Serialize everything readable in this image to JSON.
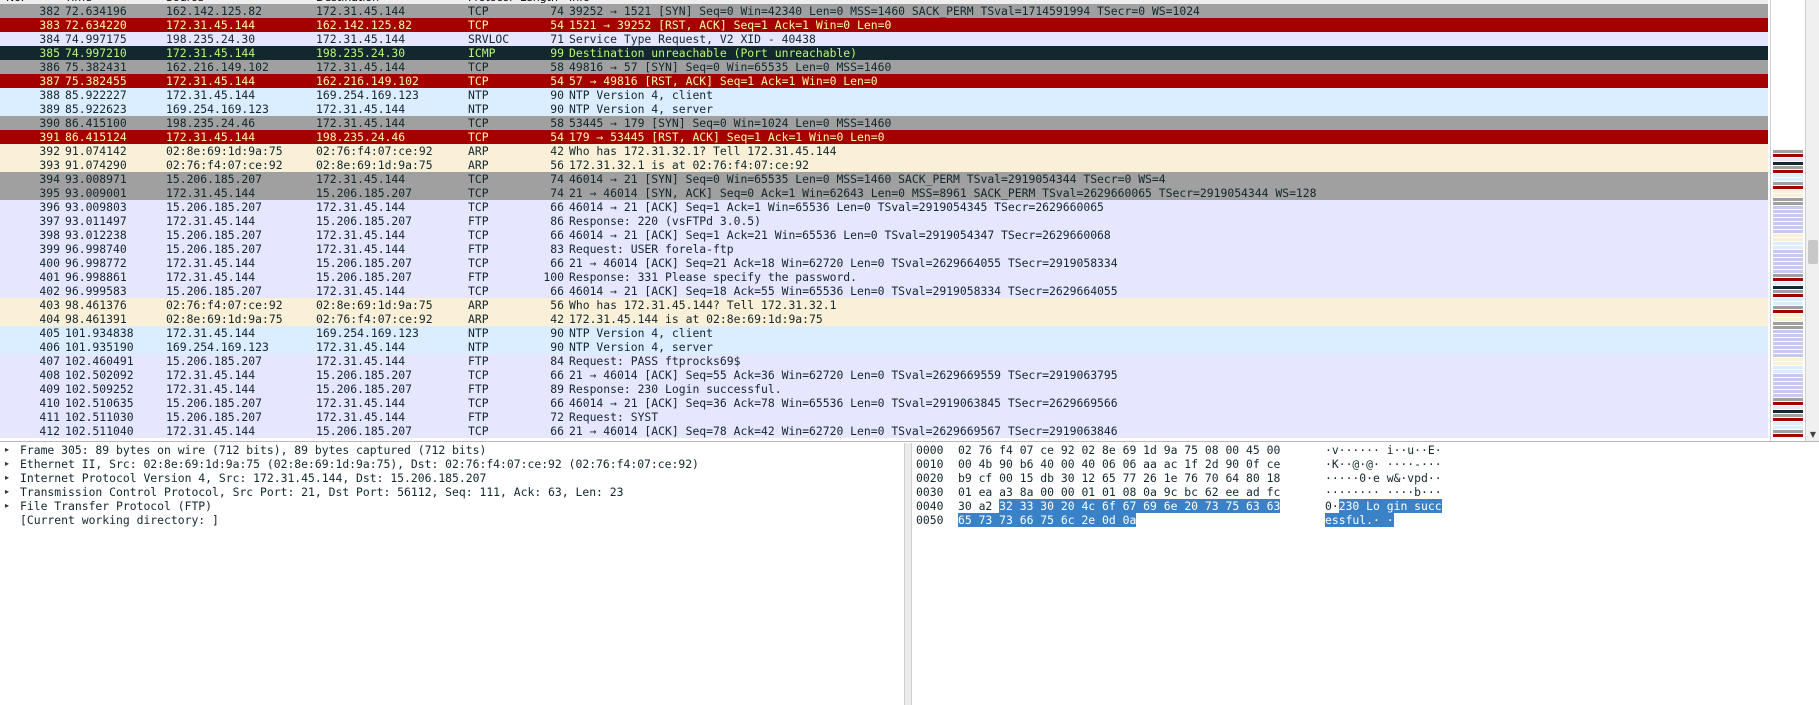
{
  "columns": [
    "No.",
    "Time",
    "Source",
    "Destination",
    "Protocol",
    "Length",
    "Info"
  ],
  "packets": [
    {
      "no": "382",
      "time": "72.634196",
      "src": "162.142.125.82",
      "dst": "172.31.45.144",
      "proto": "TCP",
      "len": "74",
      "info": "39252 → 1521 [SYN] Seq=0 Win=42340 Len=0 MSS=1460 SACK_PERM TSval=1714591994 TSecr=0 WS=1024",
      "style": "tcp-gray"
    },
    {
      "no": "383",
      "time": "72.634220",
      "src": "172.31.45.144",
      "dst": "162.142.125.82",
      "proto": "TCP",
      "len": "54",
      "info": "1521 → 39252 [RST, ACK] Seq=1 Ack=1 Win=0 Len=0",
      "style": "rst"
    },
    {
      "no": "384",
      "time": "74.997175",
      "src": "198.235.24.30",
      "dst": "172.31.45.144",
      "proto": "SRVLOC",
      "len": "71",
      "info": "Service Type Request, V2 XID - 40438",
      "style": "srvloc"
    },
    {
      "no": "385",
      "time": "74.997210",
      "src": "172.31.45.144",
      "dst": "198.235.24.30",
      "proto": "ICMP",
      "len": "99",
      "info": "Destination unreachable (Port unreachable)",
      "style": "icmp"
    },
    {
      "no": "386",
      "time": "75.382431",
      "src": "162.216.149.102",
      "dst": "172.31.45.144",
      "proto": "TCP",
      "len": "58",
      "info": "49816 → 57 [SYN] Seq=0 Win=65535 Len=0 MSS=1460",
      "style": "tcp-gray"
    },
    {
      "no": "387",
      "time": "75.382455",
      "src": "172.31.45.144",
      "dst": "162.216.149.102",
      "proto": "TCP",
      "len": "54",
      "info": "57 → 49816 [RST, ACK] Seq=1 Ack=1 Win=0 Len=0",
      "style": "rst"
    },
    {
      "no": "388",
      "time": "85.922227",
      "src": "172.31.45.144",
      "dst": "169.254.169.123",
      "proto": "NTP",
      "len": "90",
      "info": "NTP Version 4, client",
      "style": "ntp"
    },
    {
      "no": "389",
      "time": "85.922623",
      "src": "169.254.169.123",
      "dst": "172.31.45.144",
      "proto": "NTP",
      "len": "90",
      "info": "NTP Version 4, server",
      "style": "ntp"
    },
    {
      "no": "390",
      "time": "86.415100",
      "src": "198.235.24.46",
      "dst": "172.31.45.144",
      "proto": "TCP",
      "len": "58",
      "info": "53445 → 179 [SYN] Seq=0 Win=1024 Len=0 MSS=1460",
      "style": "tcp-gray"
    },
    {
      "no": "391",
      "time": "86.415124",
      "src": "172.31.45.144",
      "dst": "198.235.24.46",
      "proto": "TCP",
      "len": "54",
      "info": "179 → 53445 [RST, ACK] Seq=1 Ack=1 Win=0 Len=0",
      "style": "rst"
    },
    {
      "no": "392",
      "time": "91.074142",
      "src": "02:8e:69:1d:9a:75",
      "dst": "02:76:f4:07:ce:92",
      "proto": "ARP",
      "len": "42",
      "info": "Who has 172.31.32.1? Tell 172.31.45.144",
      "style": "arp"
    },
    {
      "no": "393",
      "time": "91.074290",
      "src": "02:76:f4:07:ce:92",
      "dst": "02:8e:69:1d:9a:75",
      "proto": "ARP",
      "len": "56",
      "info": "172.31.32.1 is at 02:76:f4:07:ce:92",
      "style": "arp"
    },
    {
      "no": "394",
      "time": "93.008971",
      "src": "15.206.185.207",
      "dst": "172.31.45.144",
      "proto": "TCP",
      "len": "74",
      "info": "46014 → 21 [SYN] Seq=0 Win=65535 Len=0 MSS=1460 SACK_PERM TSval=2919054344 TSecr=0 WS=4",
      "style": "tcp-gray"
    },
    {
      "no": "395",
      "time": "93.009001",
      "src": "172.31.45.144",
      "dst": "15.206.185.207",
      "proto": "TCP",
      "len": "74",
      "info": "21 → 46014 [SYN, ACK] Seq=0 Ack=1 Win=62643 Len=0 MSS=8961 SACK_PERM TSval=2629660065 TSecr=2919054344 WS=128",
      "style": "tcp-gray"
    },
    {
      "no": "396",
      "time": "93.009803",
      "src": "15.206.185.207",
      "dst": "172.31.45.144",
      "proto": "TCP",
      "len": "66",
      "info": "46014 → 21 [ACK] Seq=1 Ack=1 Win=65536 Len=0 TSval=2919054345 TSecr=2629660065",
      "style": "ftp"
    },
    {
      "no": "397",
      "time": "93.011497",
      "src": "172.31.45.144",
      "dst": "15.206.185.207",
      "proto": "FTP",
      "len": "86",
      "info": "Response: 220 (vsFTPd 3.0.5)",
      "style": "ftp"
    },
    {
      "no": "398",
      "time": "93.012238",
      "src": "15.206.185.207",
      "dst": "172.31.45.144",
      "proto": "TCP",
      "len": "66",
      "info": "46014 → 21 [ACK] Seq=1 Ack=21 Win=65536 Len=0 TSval=2919054347 TSecr=2629660068",
      "style": "ftp"
    },
    {
      "no": "399",
      "time": "96.998740",
      "src": "15.206.185.207",
      "dst": "172.31.45.144",
      "proto": "FTP",
      "len": "83",
      "info": "Request: USER forela-ftp",
      "style": "ftp"
    },
    {
      "no": "400",
      "time": "96.998772",
      "src": "172.31.45.144",
      "dst": "15.206.185.207",
      "proto": "TCP",
      "len": "66",
      "info": "21 → 46014 [ACK] Seq=21 Ack=18 Win=62720 Len=0 TSval=2629664055 TSecr=2919058334",
      "style": "ftp"
    },
    {
      "no": "401",
      "time": "96.998861",
      "src": "172.31.45.144",
      "dst": "15.206.185.207",
      "proto": "FTP",
      "len": "100",
      "info": "Response: 331 Please specify the password.",
      "style": "ftp"
    },
    {
      "no": "402",
      "time": "96.999583",
      "src": "15.206.185.207",
      "dst": "172.31.45.144",
      "proto": "TCP",
      "len": "66",
      "info": "46014 → 21 [ACK] Seq=18 Ack=55 Win=65536 Len=0 TSval=2919058334 TSecr=2629664055",
      "style": "ftp"
    },
    {
      "no": "403",
      "time": "98.461376",
      "src": "02:76:f4:07:ce:92",
      "dst": "02:8e:69:1d:9a:75",
      "proto": "ARP",
      "len": "56",
      "info": "Who has 172.31.45.144? Tell 172.31.32.1",
      "style": "arp"
    },
    {
      "no": "404",
      "time": "98.461391",
      "src": "02:8e:69:1d:9a:75",
      "dst": "02:76:f4:07:ce:92",
      "proto": "ARP",
      "len": "42",
      "info": "172.31.45.144 is at 02:8e:69:1d:9a:75",
      "style": "arp"
    },
    {
      "no": "405",
      "time": "101.934838",
      "src": "172.31.45.144",
      "dst": "169.254.169.123",
      "proto": "NTP",
      "len": "90",
      "info": "NTP Version 4, client",
      "style": "ntp"
    },
    {
      "no": "406",
      "time": "101.935190",
      "src": "169.254.169.123",
      "dst": "172.31.45.144",
      "proto": "NTP",
      "len": "90",
      "info": "NTP Version 4, server",
      "style": "ntp"
    },
    {
      "no": "407",
      "time": "102.460491",
      "src": "15.206.185.207",
      "dst": "172.31.45.144",
      "proto": "FTP",
      "len": "84",
      "info": "Request: PASS ftprocks69$",
      "style": "ftp"
    },
    {
      "no": "408",
      "time": "102.502092",
      "src": "172.31.45.144",
      "dst": "15.206.185.207",
      "proto": "TCP",
      "len": "66",
      "info": "21 → 46014 [ACK] Seq=55 Ack=36 Win=62720 Len=0 TSval=2629669559 TSecr=2919063795",
      "style": "ftp"
    },
    {
      "no": "409",
      "time": "102.509252",
      "src": "172.31.45.144",
      "dst": "15.206.185.207",
      "proto": "FTP",
      "len": "89",
      "info": "Response: 230 Login successful.",
      "style": "ftp"
    },
    {
      "no": "410",
      "time": "102.510635",
      "src": "15.206.185.207",
      "dst": "172.31.45.144",
      "proto": "TCP",
      "len": "66",
      "info": "46014 → 21 [ACK] Seq=36 Ack=78 Win=65536 Len=0 TSval=2919063845 TSecr=2629669566",
      "style": "ftp"
    },
    {
      "no": "411",
      "time": "102.511030",
      "src": "15.206.185.207",
      "dst": "172.31.45.144",
      "proto": "FTP",
      "len": "72",
      "info": "Request: SYST",
      "style": "ftp"
    },
    {
      "no": "412",
      "time": "102.511040",
      "src": "172.31.45.144",
      "dst": "15.206.185.207",
      "proto": "TCP",
      "len": "66",
      "info": "21 → 46014 [ACK] Seq=78 Ack=42 Win=62720 Len=0 TSval=2629669567 TSecr=2919063846",
      "style": "ftp"
    }
  ],
  "details": [
    {
      "expandable": true,
      "text": "Frame 305: 89 bytes on wire (712 bits), 89 bytes captured (712 bits)"
    },
    {
      "expandable": true,
      "text": "Ethernet II, Src: 02:8e:69:1d:9a:75 (02:8e:69:1d:9a:75), Dst: 02:76:f4:07:ce:92 (02:76:f4:07:ce:92)"
    },
    {
      "expandable": true,
      "text": "Internet Protocol Version 4, Src: 172.31.45.144, Dst: 15.206.185.207"
    },
    {
      "expandable": true,
      "text": "Transmission Control Protocol, Src Port: 21, Dst Port: 56112, Seq: 111, Ack: 63, Len: 23"
    },
    {
      "expandable": true,
      "text": "File Transfer Protocol (FTP)"
    },
    {
      "expandable": false,
      "text": "[Current working directory: ]"
    }
  ],
  "bytes": [
    {
      "offset": "0000",
      "hex": "02 76 f4 07 ce 92 02 8e  69 1d 9a 75 08 00 45 00",
      "hex_hl": "",
      "ascii": "·v······ i··u··E·",
      "ascii_hl": ""
    },
    {
      "offset": "0010",
      "hex": "00 4b 90 b6 40 00 40 06  06 aa ac 1f 2d 90 0f ce",
      "hex_hl": "",
      "ascii": "·K··@·@· ····-···",
      "ascii_hl": ""
    },
    {
      "offset": "0020",
      "hex": "b9 cf 00 15 db 30 12 65  77 26 1e 76 70 64 80 18",
      "hex_hl": "",
      "ascii": "·····0·e w&·vpd··",
      "ascii_hl": ""
    },
    {
      "offset": "0030",
      "hex": "01 ea a3 8a 00 00 01 01  08 0a 9c bc 62 ee ad fc",
      "hex_hl": "",
      "ascii": "········ ····b···",
      "ascii_hl": ""
    },
    {
      "offset": "0040",
      "hex": "30 a2 ",
      "hex_hl": "32 33 30 20 4c 6f  67 69 6e 20 73 75 63 63",
      "ascii": "0·",
      "ascii_hl": "230 Lo gin succ"
    },
    {
      "offset": "0050",
      "hex": "",
      "hex_hl": "65 73 73 66 75 6c 2e 0d  0a",
      "ascii": "",
      "ascii_hl": "essful.· ·"
    }
  ]
}
